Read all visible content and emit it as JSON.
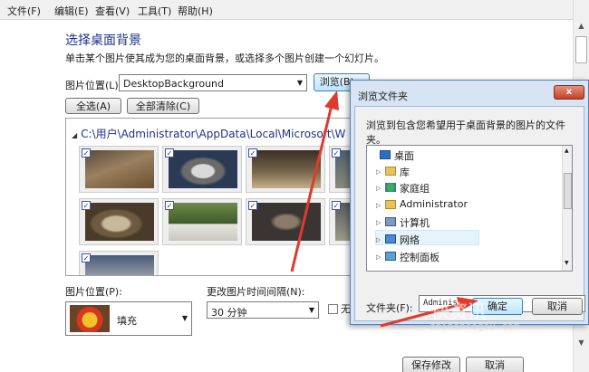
{
  "menu": [
    "文件(F)",
    "编辑(E)",
    "查看(V)",
    "工具(T)",
    "帮助(H)"
  ],
  "page": {
    "title": "选择桌面背景",
    "subtitle": "单击某个图片使其成为您的桌面背景，或选择多个图片创建一个幻灯片。",
    "location_label": "图片位置(L):",
    "location_value": "DesktopBackground",
    "browse_label": "浏览(B)...",
    "select_all_label": "全选(A)",
    "clear_all_label": "全部清除(C)",
    "folder_path": "C:\\用户\\Administrator\\AppData\\Local\\Microsoft\\W",
    "position_label": "图片位置(P):",
    "position_value": "填充",
    "interval_label": "更改图片时间间隔(N):",
    "interval_value": "30 分钟",
    "shuffle_label": "无",
    "save_label": "保存修改",
    "cancel_label": "取消"
  },
  "colors": {
    "title": "#1e3287",
    "dialog_frame": "#d6e4f3",
    "annotation_arrow": "#e03a2c"
  },
  "dialog": {
    "title": "浏览文件夹",
    "close_glyph": "x",
    "prompt": "浏览到包含您希望用于桌面背景的图片的文件夹。",
    "tree": [
      {
        "label": "桌面",
        "icon": "desktop-icon"
      },
      {
        "label": "库",
        "icon": "library-icon"
      },
      {
        "label": "家庭组",
        "icon": "homegroup-icon"
      },
      {
        "label": "Administrator",
        "icon": "user-folder-icon"
      },
      {
        "label": "计算机",
        "icon": "computer-icon"
      },
      {
        "label": "网络",
        "icon": "network-icon"
      },
      {
        "label": "控制面板",
        "icon": "control-panel-icon"
      }
    ],
    "folder_label": "文件夹(F):",
    "folder_value": "Administrator",
    "ok_label": "确定",
    "cancel_label": "取消"
  },
  "watermark": {
    "text": "快资讯",
    "url": "zhinansogou.com"
  }
}
